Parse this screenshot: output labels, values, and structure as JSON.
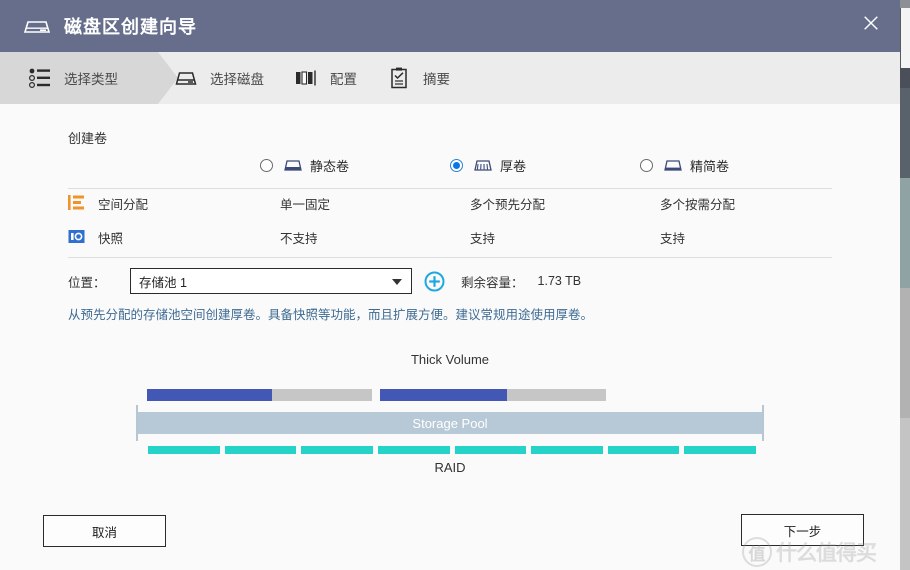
{
  "window": {
    "title": "磁盘区创建向导",
    "title_icon": "nas-drive-icon",
    "close_label": "✕",
    "accent_header": "#676e8c"
  },
  "steps": [
    {
      "label": "选择类型",
      "icon": "list-type-icon",
      "active": true
    },
    {
      "label": "选择磁盘",
      "icon": "hard-disk-icon",
      "active": false
    },
    {
      "label": "配置",
      "icon": "config-bars-icon",
      "active": false
    },
    {
      "label": "摘要",
      "icon": "clipboard-check-icon",
      "active": false
    }
  ],
  "form": {
    "section_title": "创建卷",
    "options": [
      {
        "label": "静态卷",
        "icon": "static-volume-icon",
        "selected": false
      },
      {
        "label": "厚卷",
        "icon": "thick-volume-icon",
        "selected": true
      },
      {
        "label": "精简卷",
        "icon": "thin-volume-icon",
        "selected": false
      }
    ],
    "features": [
      {
        "icon": "allocation-icon",
        "name": "空间分配",
        "values": [
          "单一固定",
          "多个预先分配",
          "多个按需分配"
        ]
      },
      {
        "icon": "snapshot-icon",
        "name": "快照",
        "values": [
          "不支持",
          "支持",
          "支持"
        ]
      }
    ],
    "location_label": "位置：",
    "location_value": "存储池 1",
    "add_pool_icon": "plus-circle-icon",
    "capacity_label": "剩余容量：",
    "capacity_value": "1.73 TB",
    "description": "从预先分配的存储池空间创建厚卷。具备快照等功能，而且扩展方便。建议常规用途使用厚卷。",
    "description_color": "#3e6b93"
  },
  "diagram": {
    "top_label": "Thick Volume",
    "pool_label": "Storage Pool",
    "bottom_label": "RAID",
    "volume_color": "#4258b4",
    "free_color": "#c6c6c6",
    "pool_color": "#b7c9d6",
    "raid_color": "#25d3c8",
    "raid_segment_count": 8
  },
  "footer": {
    "cancel_label": "取消",
    "next_label": "下一步"
  },
  "watermark": {
    "mark": "值",
    "text": "什么值得买"
  }
}
